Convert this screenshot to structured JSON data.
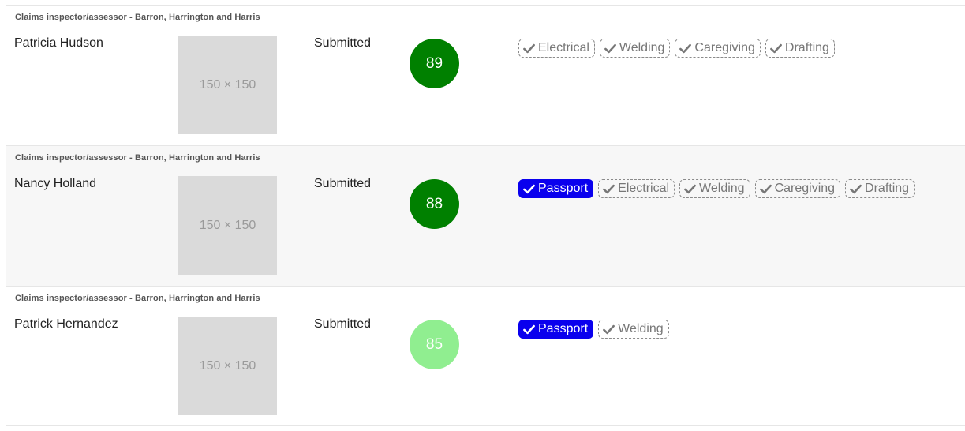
{
  "colors": {
    "score_high": "#008000",
    "score_mid": "#90ee90",
    "tag_certified_bg": "#0a00ee",
    "row_alt_bg": "#f7f7f7"
  },
  "applicants": [
    {
      "job": "Claims inspector/assessor - Barron, Harrington and Harris",
      "name": "Patricia Hudson",
      "photo_placeholder": "150 × 150",
      "status": "Submitted",
      "score": "89",
      "score_color": "#008000",
      "tags": [
        {
          "label": "Electrical",
          "style": "outline",
          "icon": "check-icon"
        },
        {
          "label": "Welding",
          "style": "outline",
          "icon": "check-icon"
        },
        {
          "label": "Caregiving",
          "style": "outline",
          "icon": "check-icon"
        },
        {
          "label": "Drafting",
          "style": "outline",
          "icon": "check-icon"
        }
      ]
    },
    {
      "job": "Claims inspector/assessor - Barron, Harrington and Harris",
      "name": "Nancy Holland",
      "photo_placeholder": "150 × 150",
      "status": "Submitted",
      "score": "88",
      "score_color": "#008000",
      "tags": [
        {
          "label": "Passport",
          "style": "solid",
          "icon": "check-icon"
        },
        {
          "label": "Electrical",
          "style": "outline",
          "icon": "check-icon"
        },
        {
          "label": "Welding",
          "style": "outline",
          "icon": "check-icon"
        },
        {
          "label": "Caregiving",
          "style": "outline",
          "icon": "check-icon"
        },
        {
          "label": "Drafting",
          "style": "outline",
          "icon": "check-icon"
        }
      ]
    },
    {
      "job": "Claims inspector/assessor - Barron, Harrington and Harris",
      "name": "Patrick Hernandez",
      "photo_placeholder": "150 × 150",
      "status": "Submitted",
      "score": "85",
      "score_color": "#90ee90",
      "tags": [
        {
          "label": "Passport",
          "style": "solid",
          "icon": "check-icon"
        },
        {
          "label": "Welding",
          "style": "outline",
          "icon": "check-icon"
        }
      ]
    }
  ]
}
